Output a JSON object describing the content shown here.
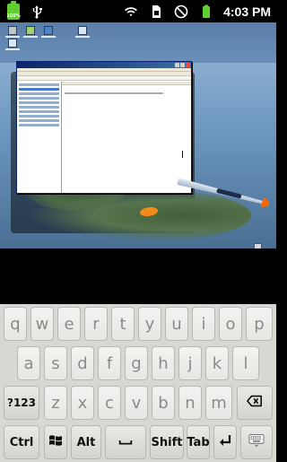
{
  "status_bar": {
    "battery_small_label": "100%",
    "time": "4:03 PM",
    "icons": [
      "battery-icon",
      "usb-icon",
      "wifi-icon",
      "sim-icon",
      "blocked-icon",
      "battery-full-icon"
    ]
  },
  "remote_desktop": {
    "desktop_icons": [
      "my-computer-icon",
      "recycle-bin-icon",
      "network-icon",
      "folder-icon"
    ],
    "window": "explorer-window",
    "taskbar": {
      "has_start_button": true,
      "task_count": 1
    }
  },
  "keyboard": {
    "row1": [
      "q",
      "w",
      "e",
      "r",
      "t",
      "y",
      "u",
      "i",
      "o",
      "p"
    ],
    "row2": [
      "a",
      "s",
      "d",
      "f",
      "g",
      "h",
      "j",
      "k",
      "l"
    ],
    "row3": [
      "?123",
      "z",
      "x",
      "c",
      "v",
      "b",
      "n",
      "m"
    ],
    "row4": [
      "Ctrl",
      "Alt",
      "Shift",
      "Tab"
    ],
    "icons": [
      "backspace-icon",
      "windows-icon",
      "space-icon",
      "enter-icon",
      "keyboard-icon"
    ]
  }
}
